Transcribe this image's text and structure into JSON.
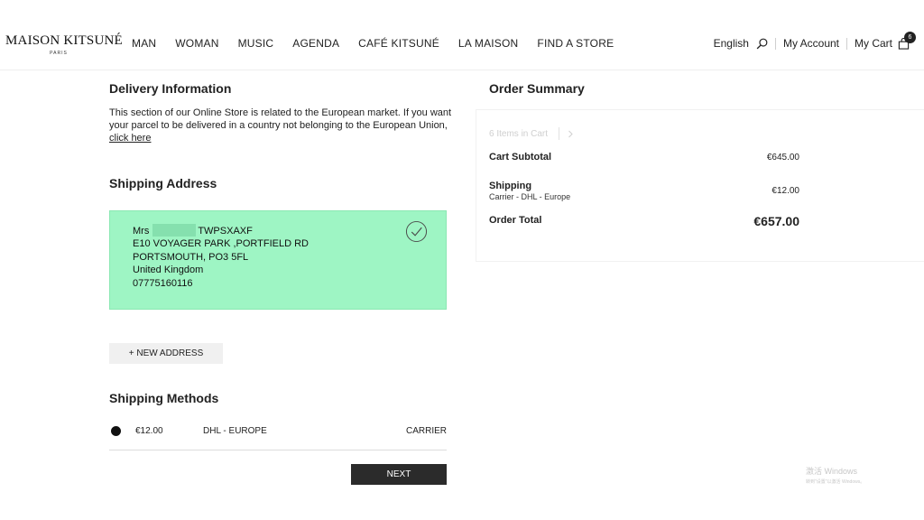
{
  "header": {
    "logo_main": "MAISON KITSUNÉ",
    "logo_sub": "PARIS",
    "nav": [
      "MAN",
      "WOMAN",
      "MUSIC",
      "AGENDA",
      "CAFÉ KITSUNÉ",
      "LA MAISON",
      "FIND A STORE"
    ],
    "language": "English",
    "account": "My Account",
    "cart": "My Cart",
    "cart_count": "6"
  },
  "delivery": {
    "title": "Delivery Information",
    "text": "This section of our Online Store is related to the European market. If you want your parcel to be delivered in a country not belonging to the European Union,",
    "link": "click here"
  },
  "shipping_address": {
    "title": "Shipping Address",
    "salutation": "Mrs",
    "name": "TWPSXAXF",
    "lines": [
      "E10 VOYAGER PARK ,PORTFIELD RD",
      "PORTSMOUTH, PO3 5FL",
      "United Kingdom",
      "07775160116"
    ],
    "card_color": "#9ef5c4"
  },
  "new_address_label": "+ NEW ADDRESS",
  "shipping_methods": {
    "title": "Shipping Methods",
    "price": "€12.00",
    "name": "DHL - EUROPE",
    "carrier": "CARRIER"
  },
  "next_label": "NEXT",
  "summary": {
    "title": "Order Summary",
    "items_in_cart": "6 Items in Cart",
    "subtotal_label": "Cart Subtotal",
    "subtotal_value": "€645.00",
    "shipping_label": "Shipping",
    "shipping_sub": "Carrier - DHL - Europe",
    "shipping_value": "€12.00",
    "total_label": "Order Total",
    "total_value": "€657.00"
  },
  "watermark": {
    "line1": "激活 Windows",
    "line2": "转到\"设置\"以激活 Windows。"
  }
}
